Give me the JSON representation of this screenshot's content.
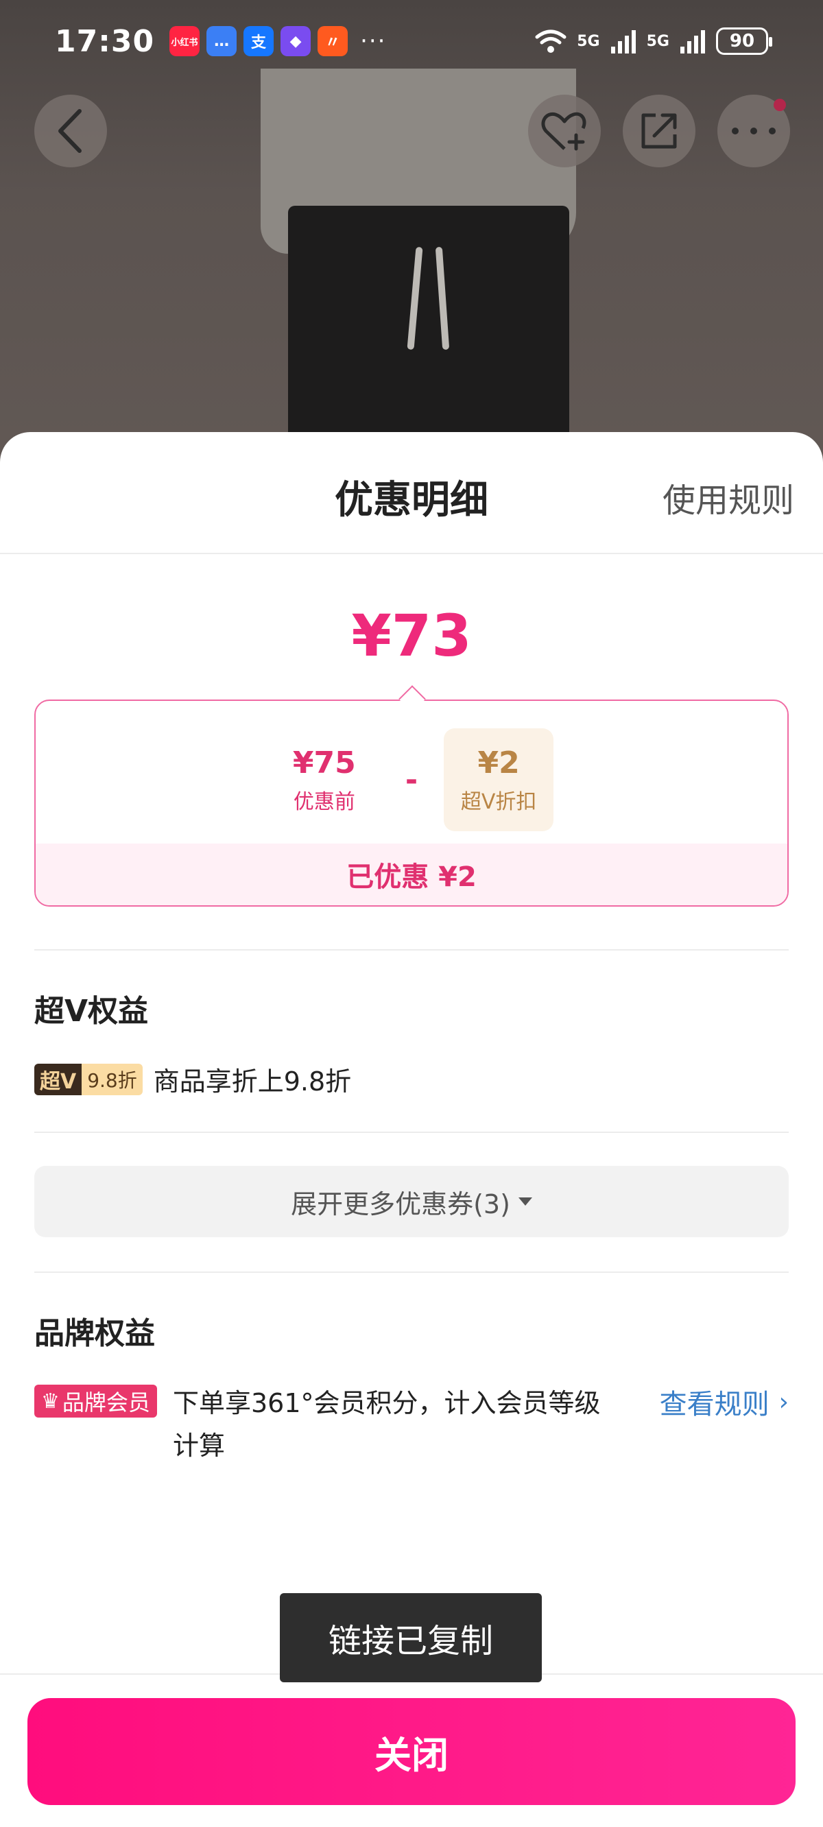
{
  "status_bar": {
    "time": "17:30",
    "apps": [
      {
        "name": "xiaohongshu-icon",
        "text": "小红书",
        "color": "#ff2442"
      },
      {
        "name": "message-icon",
        "text": "…",
        "color": "#3b7ff5"
      },
      {
        "name": "alipay-icon",
        "text": "支",
        "color": "#1677ff"
      },
      {
        "name": "app-diamond-icon",
        "text": "◆",
        "color": "#7a4cf0"
      },
      {
        "name": "app-orange-icon",
        "text": "〃",
        "color": "#ff5a1f"
      }
    ],
    "more": "···",
    "signal_1": "5G",
    "signal_2": "5G",
    "battery": "90"
  },
  "sheet": {
    "title": "优惠明细",
    "rules_link": "使用规则",
    "final_price": "¥73",
    "before": {
      "amount": "¥75",
      "label": "优惠前"
    },
    "minus": "-",
    "discount": {
      "amount": "¥2",
      "label": "超V折扣"
    },
    "saved": "已优惠 ¥2",
    "vip_section": {
      "title": "超V权益",
      "badge_dark": "超V",
      "badge_light": "9.8折",
      "text": "商品享折上9.8折"
    },
    "expand": "展开更多优惠券(3)",
    "brand_section": {
      "title": "品牌权益",
      "badge": "品牌会员",
      "text": "下单享361°会员积分，计入会员等级计算",
      "link": "查看规则"
    }
  },
  "toast": "链接已复制",
  "close_button": "关闭",
  "colors": {
    "accent_pink": "#ee2a7b",
    "gold": "#b98545",
    "link_blue": "#3a7fc8"
  }
}
